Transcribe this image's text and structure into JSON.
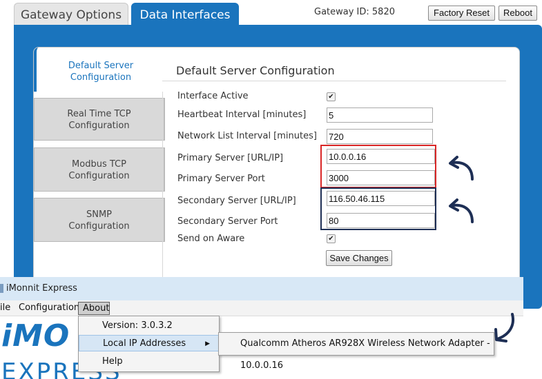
{
  "tabs": [
    {
      "label": "Gateway Options",
      "active": false
    },
    {
      "label": "Data Interfaces",
      "active": true
    }
  ],
  "gateway_id": "Gateway ID: 5820",
  "buttons": {
    "factory_reset": "Factory Reset",
    "reboot": "Reboot"
  },
  "side_tabs": [
    {
      "line1": "Default Server",
      "line2": "Configuration",
      "active": true
    },
    {
      "line1": "Real Time TCP",
      "line2": "Configuration",
      "active": false
    },
    {
      "line1": "Modbus TCP",
      "line2": "Configuration",
      "active": false
    },
    {
      "line1": "SNMP",
      "line2": "Configuration",
      "active": false
    }
  ],
  "form": {
    "title": "Default Server Configuration",
    "interface_active": {
      "label": "Interface Active",
      "checked": true
    },
    "heartbeat": {
      "label": "Heartbeat Interval [minutes]",
      "value": "5"
    },
    "network_list": {
      "label": "Network List Interval [minutes]",
      "value": "720"
    },
    "primary_server": {
      "label": "Primary Server [URL/IP]",
      "value": "10.0.0.16"
    },
    "primary_port": {
      "label": "Primary Server Port",
      "value": "3000"
    },
    "secondary_server": {
      "label": "Secondary Server [URL/IP]",
      "value": "116.50.46.115"
    },
    "secondary_port": {
      "label": "Secondary Server Port",
      "value": "80"
    },
    "send_on_aware": {
      "label": "Send on Aware",
      "checked": true
    },
    "save_label": "Save Changes"
  },
  "colors": {
    "accent": "#1a74bd",
    "primary_highlight": "#d92626",
    "secondary_highlight": "#1e2f55"
  },
  "app": {
    "title": "iMonnit Express",
    "menu": [
      "ile",
      "Configuration",
      "About"
    ],
    "dropdown": [
      "Version: 3.0.3.2",
      "Local IP Addresses",
      "Help"
    ],
    "submenu_item": "Qualcomm Atheros AR928X Wireless Network Adapter - 10.0.0.16",
    "logo_text": "iMO",
    "logo_sub": "EXPRESS"
  }
}
